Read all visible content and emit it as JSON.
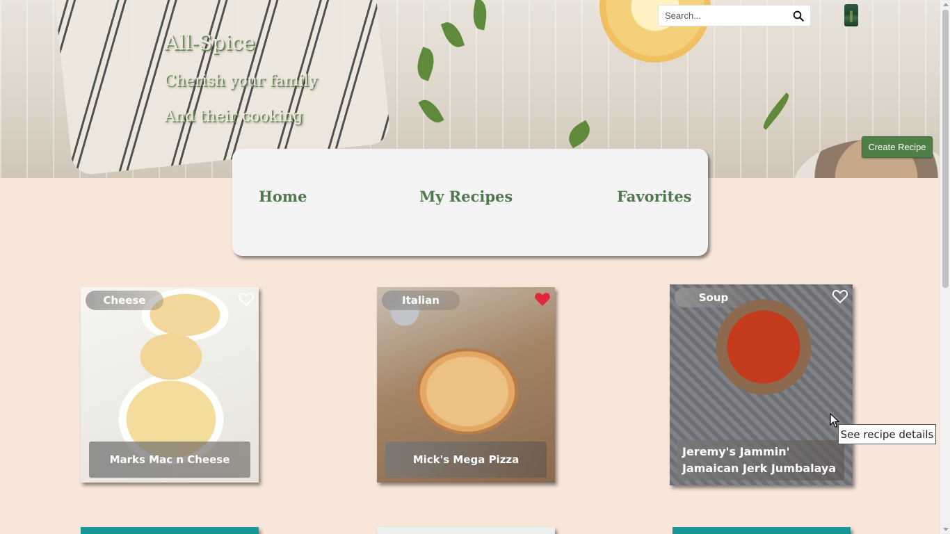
{
  "header": {
    "brand": "All-Spice",
    "tagline_1": "Cherish your family",
    "tagline_2": "And their cooking",
    "search_placeholder": "Search...",
    "create_label": "Create Recipe"
  },
  "nav": {
    "home": "Home",
    "my_recipes": "My Recipes",
    "favorites": "Favorites"
  },
  "recipes": [
    {
      "category": "Cheese",
      "title": "Marks Mac n Cheese",
      "favorited": false
    },
    {
      "category": "Italian",
      "title": "Mick's Mega Pizza",
      "favorited": true
    },
    {
      "category": "Soup",
      "title": "Jeremy's Jammin' Jamaican Jerk Jumbalaya",
      "favorited": false
    }
  ],
  "tooltip": "See recipe details",
  "colors": {
    "accent_green": "#4f8047",
    "nav_text": "#4f7a4c",
    "page_bg": "#f9e6da",
    "heart_active": "#e0283a"
  },
  "icons": {
    "search": "search-icon",
    "heart_empty": "heart-outline-icon",
    "heart_filled": "heart-filled-icon"
  }
}
